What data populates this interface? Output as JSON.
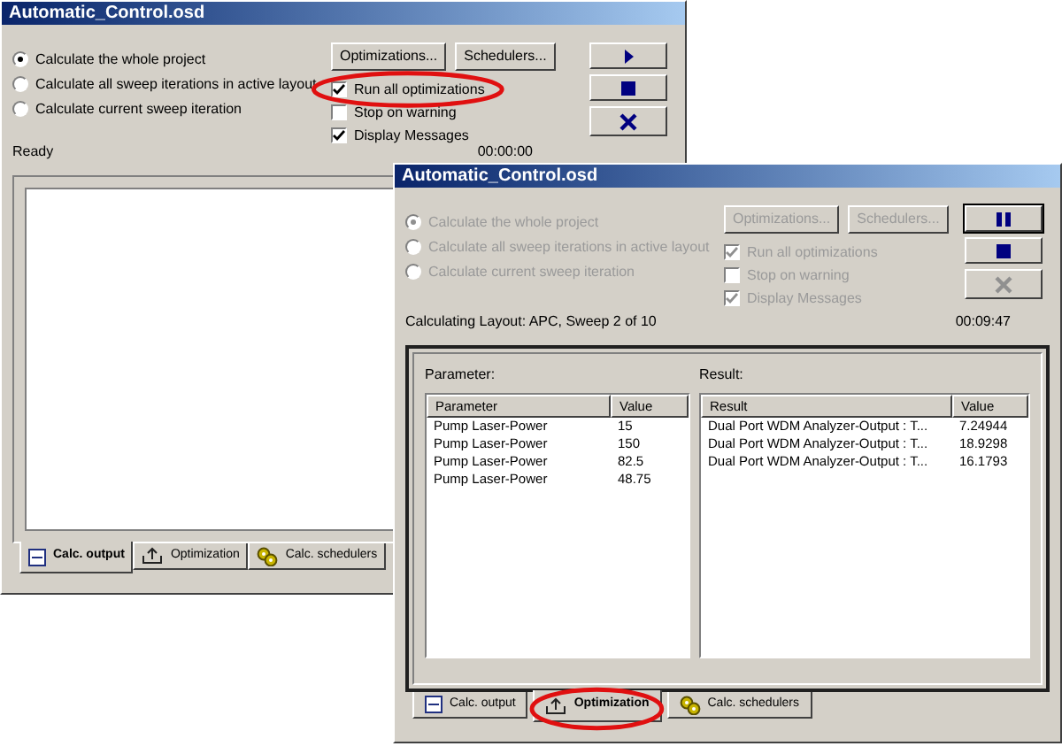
{
  "windows": [
    {
      "title": "Automatic_Control.osd",
      "disabled": false,
      "options": [
        {
          "label": "Calculate the whole project",
          "selected": true
        },
        {
          "label": "Calculate all sweep iterations in active layout",
          "selected": false
        },
        {
          "label": "Calculate current sweep iteration",
          "selected": false
        }
      ],
      "buttons": [
        "Optimizations...",
        "Schedulers..."
      ],
      "checkboxes": [
        {
          "label": "Run all optimizations",
          "checked": true,
          "circled": true
        },
        {
          "label": "Stop on warning",
          "checked": false,
          "circled": false
        },
        {
          "label": "Display Messages",
          "checked": true,
          "circled": false
        }
      ],
      "actions": [
        {
          "kind": "play"
        },
        {
          "kind": "stop"
        },
        {
          "kind": "cancel"
        }
      ],
      "status": "Ready",
      "time": "00:00:00",
      "tabs": [
        {
          "label": "Calc. output",
          "kind": "output",
          "selected": true,
          "circled": false
        },
        {
          "label": "Optimization",
          "kind": "optimization",
          "selected": false,
          "circled": false
        },
        {
          "label": "Calc. schedulers",
          "kind": "schedulers",
          "selected": false,
          "circled": false
        }
      ]
    },
    {
      "title": "Automatic_Control.osd",
      "disabled": true,
      "options": [
        {
          "label": "Calculate the whole project",
          "selected": true
        },
        {
          "label": "Calculate all sweep iterations in active layout",
          "selected": false
        },
        {
          "label": "Calculate current sweep iteration",
          "selected": false
        }
      ],
      "buttons": [
        "Optimizations...",
        "Schedulers..."
      ],
      "checkboxes": [
        {
          "label": "Run all optimizations",
          "checked": true,
          "circled": false
        },
        {
          "label": "Stop on warning",
          "checked": false,
          "circled": false
        },
        {
          "label": "Display Messages",
          "checked": true,
          "circled": false
        }
      ],
      "actions": [
        {
          "kind": "pause"
        },
        {
          "kind": "stop"
        },
        {
          "kind": "cancel"
        }
      ],
      "status": "Calculating Layout: APC, Sweep 2 of 10",
      "time": "00:09:47",
      "parameter_panel": {
        "label": "Parameter:",
        "columns": [
          "Parameter",
          "Value"
        ],
        "rows": [
          [
            "Pump Laser-Power",
            "15"
          ],
          [
            "Pump Laser-Power",
            "150"
          ],
          [
            "Pump Laser-Power",
            "82.5"
          ],
          [
            "Pump Laser-Power",
            "48.75"
          ]
        ]
      },
      "result_panel": {
        "label": "Result:",
        "columns": [
          "Result",
          "Value"
        ],
        "rows": [
          [
            "Dual Port WDM Analyzer-Output : T...",
            "7.24944"
          ],
          [
            "Dual Port WDM Analyzer-Output : T...",
            "18.9298"
          ],
          [
            "Dual Port WDM Analyzer-Output : T...",
            "16.1793"
          ]
        ]
      },
      "tabs": [
        {
          "label": "Calc. output",
          "kind": "output",
          "selected": false,
          "circled": false
        },
        {
          "label": "Optimization",
          "kind": "optimization",
          "selected": true,
          "circled": true
        },
        {
          "label": "Calc. schedulers",
          "kind": "schedulers",
          "selected": false,
          "circled": false
        }
      ]
    }
  ]
}
